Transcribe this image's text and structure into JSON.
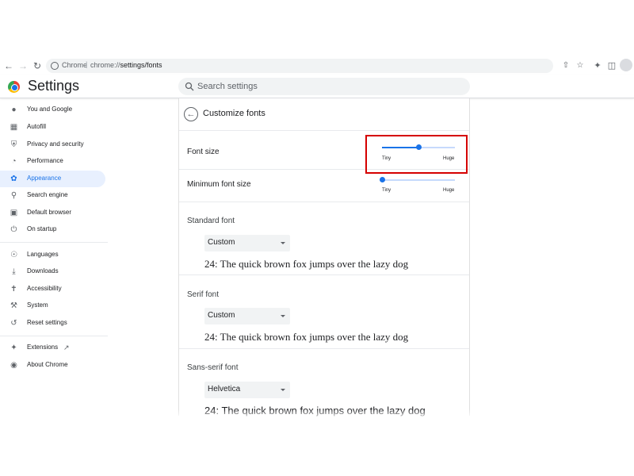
{
  "browser": {
    "site_chip": "Chrome",
    "url_prefix": "chrome://",
    "url_path": "settings/fonts",
    "icons": [
      "back-arrow-icon",
      "forward-arrow-icon",
      "reload-icon",
      "share-icon",
      "star-icon",
      "extensions-icon",
      "side-panel-icon",
      "profile-avatar"
    ]
  },
  "header": {
    "title": "Settings",
    "search_placeholder": "Search settings"
  },
  "sidebar": {
    "items": [
      {
        "label": "You and Google",
        "icon": "person-icon",
        "active": false
      },
      {
        "label": "Autofill",
        "icon": "clipboard-icon",
        "active": false
      },
      {
        "label": "Privacy and security",
        "icon": "shield-icon",
        "active": false
      },
      {
        "label": "Performance",
        "icon": "speedometer-icon",
        "active": false
      },
      {
        "label": "Appearance",
        "icon": "palette-icon",
        "active": true
      },
      {
        "label": "Search engine",
        "icon": "search-icon",
        "active": false
      },
      {
        "label": "Default browser",
        "icon": "browser-window-icon",
        "active": false
      },
      {
        "label": "On startup",
        "icon": "power-icon",
        "active": false
      },
      {
        "label": "Languages",
        "icon": "globe-icon",
        "active": false
      },
      {
        "label": "Downloads",
        "icon": "download-icon",
        "active": false
      },
      {
        "label": "Accessibility",
        "icon": "accessibility-icon",
        "active": false
      },
      {
        "label": "System",
        "icon": "wrench-icon",
        "active": false
      },
      {
        "label": "Reset settings",
        "icon": "history-icon",
        "active": false
      },
      {
        "label": "Extensions",
        "icon": "puzzle-icon",
        "active": false
      },
      {
        "label": "About Chrome",
        "icon": "chrome-icon",
        "active": false
      }
    ]
  },
  "main": {
    "title": "Customize fonts",
    "font_size": {
      "label": "Font size",
      "min_label": "Tiny",
      "max_label": "Huge",
      "value_fraction": 0.5
    },
    "min_font_size": {
      "label": "Minimum font size",
      "min_label": "Tiny",
      "max_label": "Huge",
      "value_fraction": 0.0
    },
    "standard_font": {
      "label": "Standard font",
      "value": "Custom",
      "sample": "24: The quick brown fox jumps over the lazy dog"
    },
    "serif_font": {
      "label": "Serif font",
      "value": "Custom",
      "sample": "24: The quick brown fox jumps over the lazy dog"
    },
    "sans_serif_font": {
      "label": "Sans-serif font",
      "value": "Helvetica",
      "sample": "24: The quick brown fox jumps over the lazy dog"
    }
  },
  "colors": {
    "accent": "#1a73e8",
    "highlight_border": "#d50000",
    "active_nav_bg": "#e8f0fe"
  }
}
